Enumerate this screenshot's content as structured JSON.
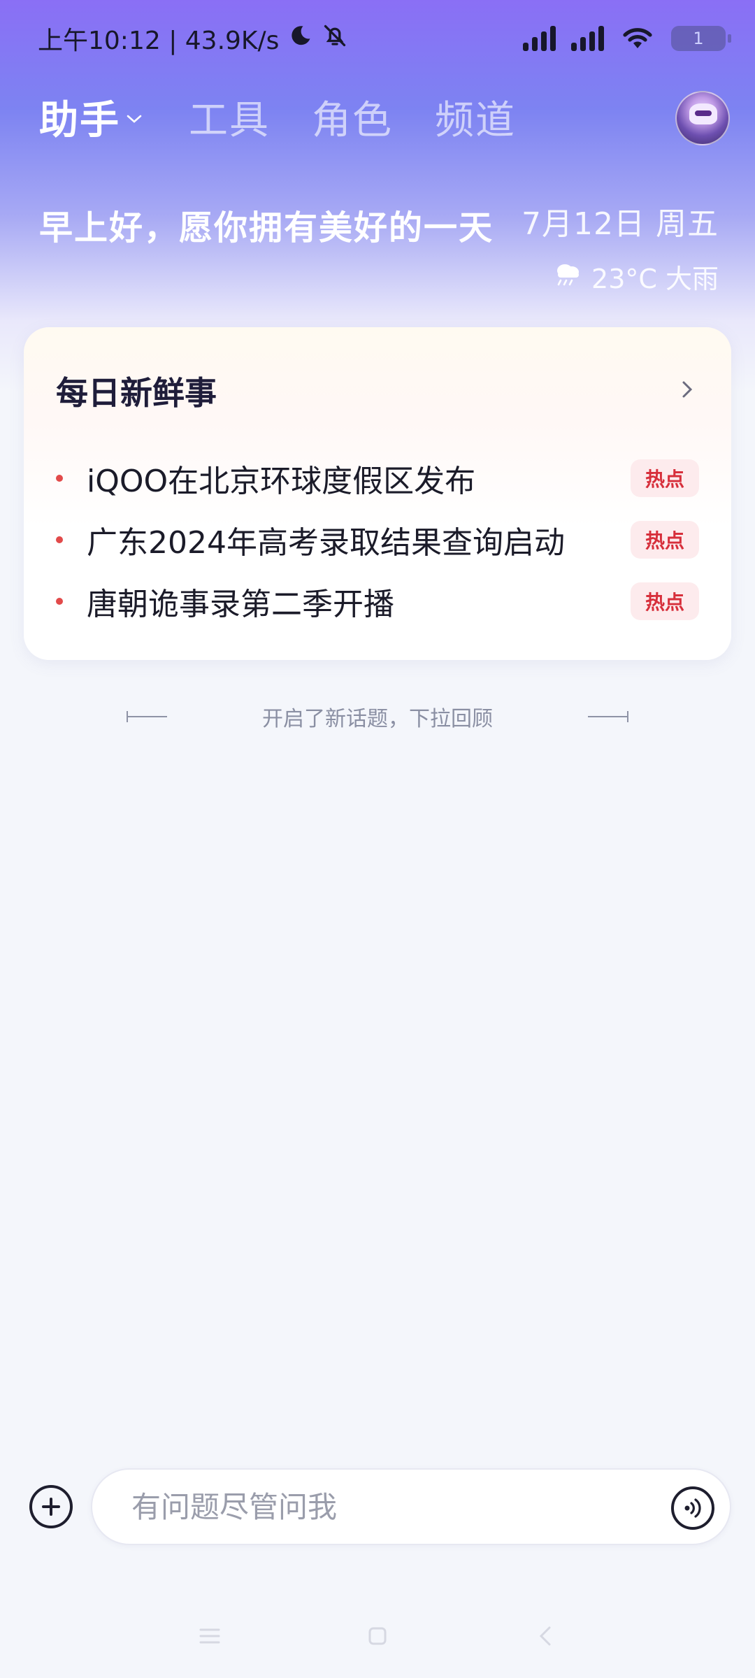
{
  "status_bar": {
    "time_speed": "上午10:12 | 43.9K/s",
    "battery": "1"
  },
  "nav": {
    "tabs": [
      {
        "label": "助手",
        "active": true
      },
      {
        "label": "工具",
        "active": false
      },
      {
        "label": "角色",
        "active": false
      },
      {
        "label": "频道",
        "active": false
      }
    ]
  },
  "greeting": {
    "text": "早上好，愿你拥有美好的一天",
    "date": "7月12日 周五",
    "weather": "23°C 大雨",
    "weather_icon": "rain-cloud-icon"
  },
  "news_card": {
    "title": "每日新鲜事",
    "items": [
      {
        "text": "iQOO在北京环球度假区发布",
        "badge": "热点"
      },
      {
        "text": "广东2024年高考录取结果查询启动",
        "badge": "热点"
      },
      {
        "text": "唐朝诡事录第二季开播",
        "badge": "热点"
      }
    ]
  },
  "topic_hint": "开启了新话题，下拉回顾",
  "input": {
    "placeholder": "有问题尽管问我"
  },
  "colors": {
    "accent": "#8a6ff5",
    "hot_badge_bg": "#fdebed",
    "hot_badge_text": "#d72f3b",
    "bullet": "#e24a4a"
  }
}
